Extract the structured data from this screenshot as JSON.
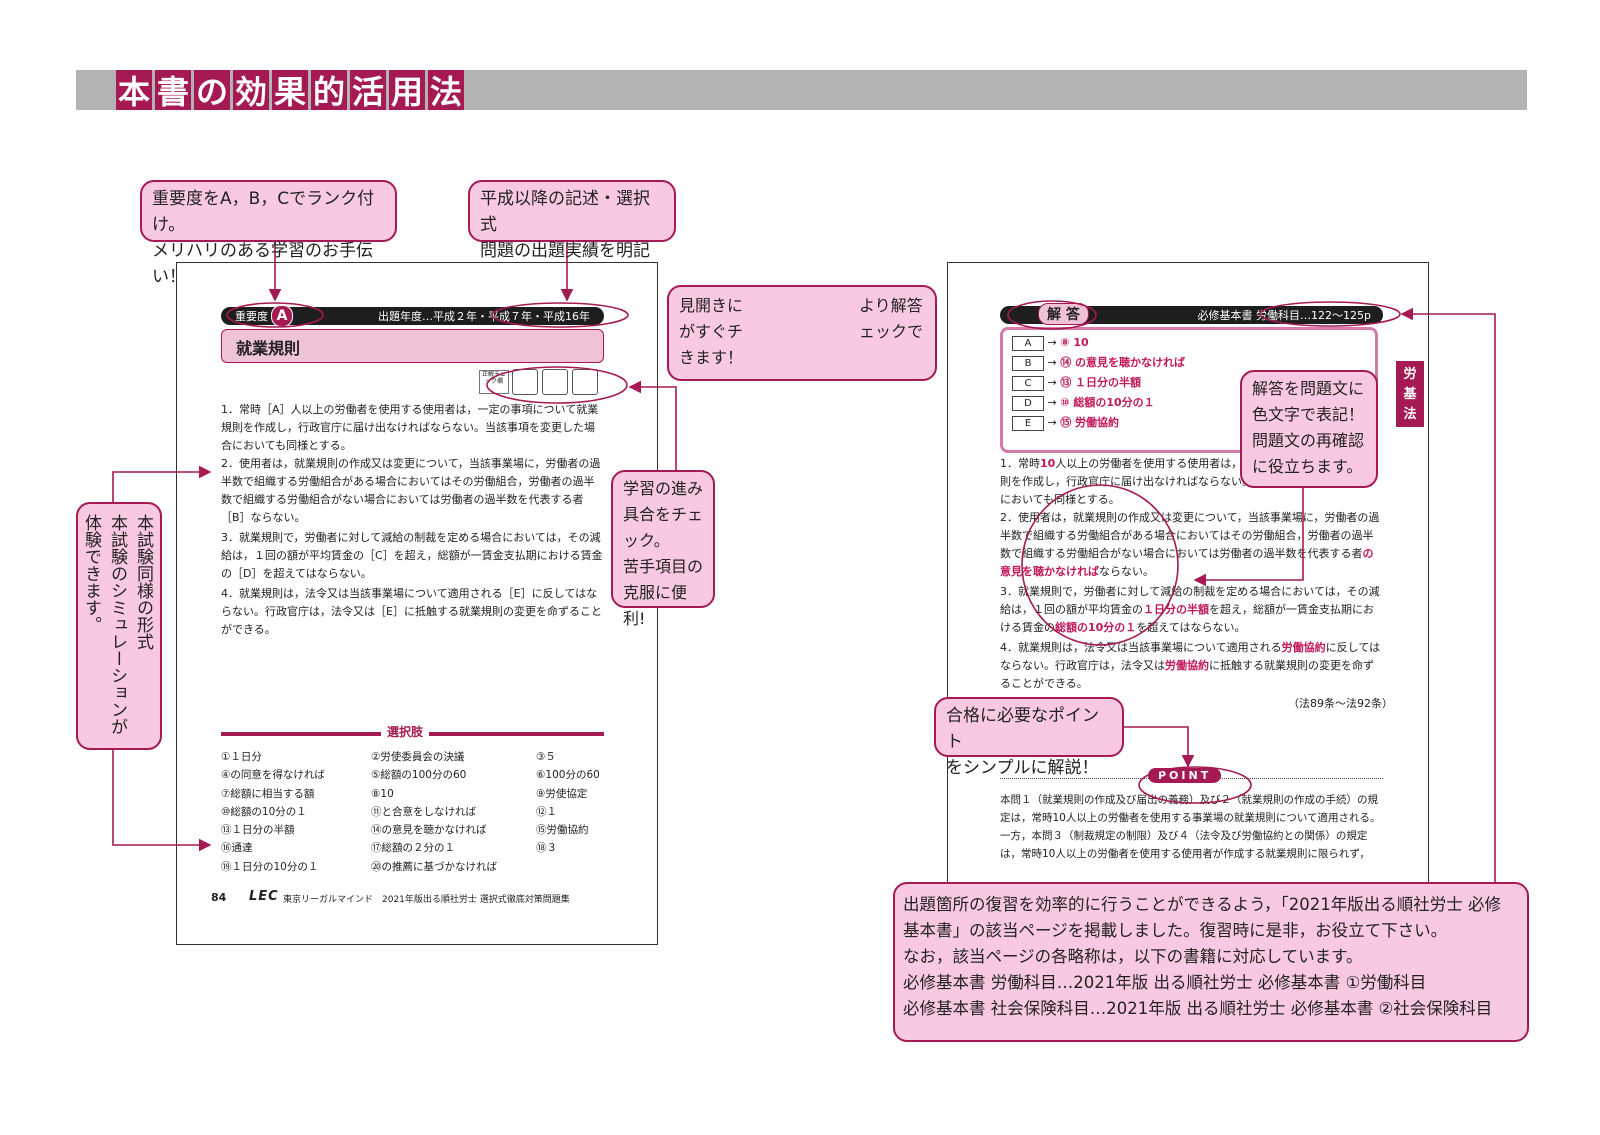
{
  "header": {
    "title_chars": [
      "本",
      "書",
      "の",
      "効",
      "果",
      "的",
      "活",
      "用",
      "法"
    ]
  },
  "callouts": {
    "rank": [
      "重要度をA，B，Cでランク付け。",
      "メリハリのある学習のお手伝い！"
    ],
    "history": [
      "平成以降の記述・選択式",
      "問題の出題実績を明記"
    ],
    "spread": [
      "見開きに",
      "より解答",
      "がすぐチ",
      "ェックで",
      "きます！"
    ],
    "progress": [
      "学習の進み",
      "具合をチェ",
      "ック。",
      "苦手項目の",
      "克服に便利!"
    ],
    "simulation": [
      "本試験同様の形式",
      "本試験のシミュレーションが",
      "体験できます。"
    ],
    "answer_color": [
      "解答を問題文に",
      "色文字で表記！",
      "問題文の再確認",
      "に役立ちます。"
    ],
    "point": [
      "合格に必要なポイント",
      "をシンプルに解説！"
    ],
    "reference": [
      "出題箇所の復習を効率的に行うことができるよう，「2021年版出る順社労士 必修",
      "基本書」の該当ページを掲載しました。復習時に是非，お役立て下さい。",
      "なお，該当ページの各略称は，以下の書籍に対応しています。",
      "必修基本書 労働科目…2021年版 出る順社労士 必修基本書 ①労働科目",
      "必修基本書 社会保険科目…2021年版 出る順社労士 必修基本書 ②社会保険科目"
    ]
  },
  "left_page": {
    "importance_label": "重要度",
    "importance_grade": "A",
    "history": "出題年度…平成２年・平成７年・平成16年",
    "topic": "就業規則",
    "check_label": "正解チェック欄",
    "questions": [
      "1．常時［A］人以上の労働者を使用する使用者は，一定の事項について就業規則を作成し，行政官庁に届け出なければならない。当該事項を変更した場合においても同様とする。",
      "2．使用者は，就業規則の作成又は変更について，当該事業場に，労働者の過半数で組織する労働組合がある場合においてはその労働組合，労働者の過半数で組織する労働組合がない場合においては労働者の過半数を代表する者［B］ならない。",
      "3．就業規則で，労働者に対して減給の制裁を定める場合においては，その減給は，１回の額が平均賃金の［C］を超え，総額が一賃金支払期における賃金の［D］を超えてはならない。",
      "4．就業規則は，法令又は当該事業場について適用される［E］に反してはならない。行政官庁は，法令又は［E］に抵触する就業規則の変更を命ずることができる。"
    ],
    "choices_title": "選択肢",
    "choices": [
      "①１日分",
      "②労使委員会の決議",
      "③５",
      "④の同意を得なければ",
      "⑤総額の100分の60",
      "⑥100分の60",
      "⑦総額に相当する額",
      "⑧10",
      "⑨労使協定",
      "⑩総額の10分の１",
      "⑪と合意をしなければ",
      "⑫１",
      "⑬１日分の半額",
      "⑭の意見を聴かなければ",
      "⑮労働協約",
      "⑯通達",
      "⑰総額の２分の１",
      "⑱３",
      "⑲１日分の10分の１",
      "⑳の推薦に基づかなければ",
      ""
    ],
    "page_number": "84",
    "logo": "LEC",
    "footer_title": "東京リーガルマインド　2021年版出る順社労士 選択式徹底対策問題集"
  },
  "right_page": {
    "answer_label": "解 答",
    "reference": "必修基本書 労働科目…122〜125p",
    "side_tab": [
      "労",
      "基",
      "法"
    ],
    "answers": [
      {
        "key": "A",
        "value": "⑧ 10"
      },
      {
        "key": "B",
        "value": "⑭ の意見を聴かなければ"
      },
      {
        "key": "C",
        "value": "⑬ １日分の半額"
      },
      {
        "key": "D",
        "value": "⑩ 総額の10分の１"
      },
      {
        "key": "E",
        "value": "⑮ 労働協約"
      }
    ],
    "q1": [
      "1．常時",
      "10",
      "人以上の労働者を使用する使用者は，一定の事項について就業規則を作成し，行政官庁に届け出なければならない。当該事項を変更した場合においても同様とする。"
    ],
    "q2": [
      "2．使用者は，就業規則の作成又は変更について，当該事業場に，労働者の過半数で組織する労働組合がある場合においてはその労働組合，労働者の過半数で組織する労働組合がない場合においては労働者の過半数を代表する者",
      "の意見を聴かなければ",
      "ならない。"
    ],
    "q3": [
      "3．就業規則で，労働者に対して減給の制裁を定める場合においては，その減給は，１回の額が平均賃金の",
      "１日分の半額",
      "を超え，総額が一賃金支払期における賃金の",
      "総額の10分の１",
      "を超えてはならない。"
    ],
    "q4": [
      "4．就業規則は，法令又は当該事業場について適用される",
      "労働協約",
      "に反してはならない。行政官庁は，法令又は",
      "労働協約",
      "に抵触する就業規則の変更を命ずることができる。"
    ],
    "law_ref": "（法89条〜法92条）",
    "point_label": "POINT",
    "point_text": "本問１（就業規則の作成及び届出の義務）及び２（就業規則の作成の手続）の規定は，常時10人以上の労働者を使用する事業場の就業規則について適用される。一方，本問３（制裁規定の制限）及び４（法令及び労働協約との関係）の規定は，常時10人以上の労働者を使用する使用者が作成する就業規則に限られず，"
  },
  "colors": {
    "accent": "#a51a52",
    "callout_fill": "#f8c9e1",
    "header_gray": "#b3b3b3",
    "answer_pink": "#c2185b"
  }
}
